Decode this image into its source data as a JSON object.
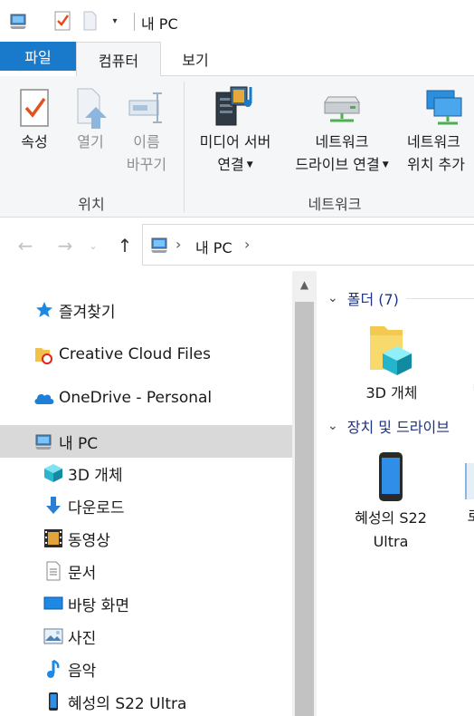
{
  "window": {
    "title": "내 PC"
  },
  "ribbon_tabs": {
    "file": "파일",
    "computer": "컴퓨터",
    "view": "보기"
  },
  "ribbon": {
    "location_group": {
      "label": "위치",
      "properties": "속성",
      "open": "열기",
      "rename_line1": "이름",
      "rename_line2": "바꾸기"
    },
    "network_group": {
      "label": "네트워크",
      "media_line1": "미디어 서버",
      "media_line2": "연결",
      "map_drive_line1": "네트워크",
      "map_drive_line2": "드라이브 연결",
      "add_location_line1": "네트워크",
      "add_location_line2": "위치 추가"
    }
  },
  "address": {
    "crumb": "내 PC"
  },
  "nav_pane": {
    "items": [
      {
        "label": "즐겨찾기",
        "icon": "star-icon"
      },
      {
        "label": "Creative Cloud Files",
        "icon": "creative-cloud-folder-icon"
      },
      {
        "label": "OneDrive - Personal",
        "icon": "cloud-icon"
      },
      {
        "label": "내 PC",
        "icon": "computer-icon",
        "selected": true
      },
      {
        "label": "3D 개체",
        "icon": "3d-cube-icon"
      },
      {
        "label": "다운로드",
        "icon": "download-arrow-icon"
      },
      {
        "label": "동영상",
        "icon": "film-icon"
      },
      {
        "label": "문서",
        "icon": "document-icon"
      },
      {
        "label": "바탕 화면",
        "icon": "desktop-icon"
      },
      {
        "label": "사진",
        "icon": "picture-icon"
      },
      {
        "label": "음악",
        "icon": "music-note-icon"
      },
      {
        "label": "혜성의 S22 Ultra",
        "icon": "phone-icon"
      }
    ]
  },
  "content": {
    "folders_header": "폴더 (7)",
    "devices_header": "장치 및 드라이브",
    "folder_tile": "3D 개체",
    "device_tile_line1": "혜성의 S22",
    "device_tile_line2": "Ultra"
  },
  "colors": {
    "file_tab": "#1979ca",
    "section_header": "#1e3287",
    "selection": "#d9d9d9"
  }
}
